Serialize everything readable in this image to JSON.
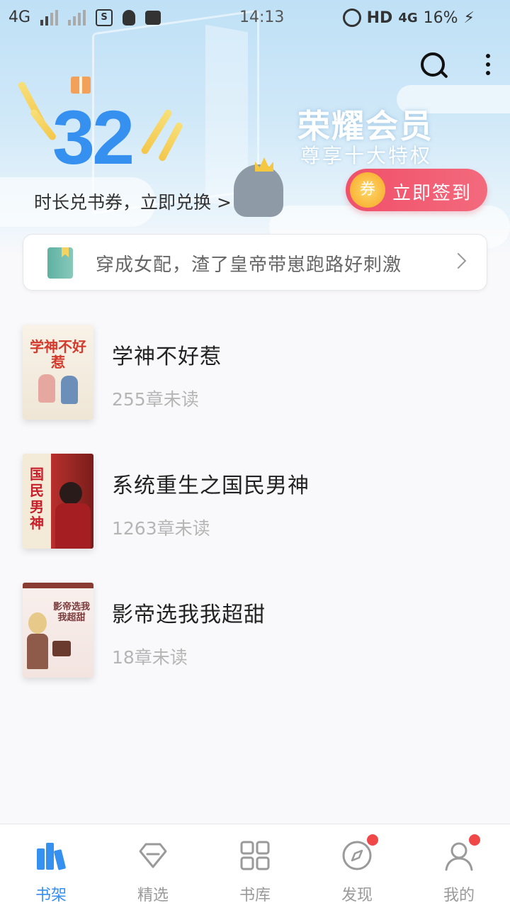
{
  "status_bar": {
    "network": "4G",
    "time": "14:13",
    "hd": "HD",
    "network2": "4G",
    "battery": "16%"
  },
  "header": {
    "coupon_count": "32",
    "coupon_text": "时长兑书券，立即兑换 >",
    "vip_title": "荣耀会员",
    "vip_subtitle": "尊享十大特权",
    "checkin_coin": "券",
    "checkin_label": "立即签到"
  },
  "recommend": {
    "text": "穿成女配，渣了皇帝带崽跑路好刺激"
  },
  "books": [
    {
      "title": "学神不好惹",
      "progress": "255章未读",
      "cover_text": "学神不好惹",
      "cover_color": "#f3ece0",
      "cover_text_color": "#d33a2c"
    },
    {
      "title": "系统重生之国民男神",
      "progress": "1263章未读",
      "cover_text": "国民男神",
      "cover_color": "#b8302c",
      "cover_text_color": "#c8202a"
    },
    {
      "title": "影帝选我我超甜",
      "progress": "18章未读",
      "cover_text": "影帝选我我超甜",
      "cover_color": "#f6ecea",
      "cover_text_color": "#7a3a3a"
    }
  ],
  "nav": [
    {
      "label": "书架",
      "icon": "bookshelf-icon",
      "active": true
    },
    {
      "label": "精选",
      "icon": "diamond-icon",
      "active": false
    },
    {
      "label": "书库",
      "icon": "grid-icon",
      "active": false
    },
    {
      "label": "发现",
      "icon": "compass-icon",
      "active": false,
      "badge": true
    },
    {
      "label": "我的",
      "icon": "user-icon",
      "active": false,
      "badge": true
    }
  ],
  "colors": {
    "accent": "#3590f0",
    "checkin": "#f0506a",
    "badge": "#f04848"
  }
}
